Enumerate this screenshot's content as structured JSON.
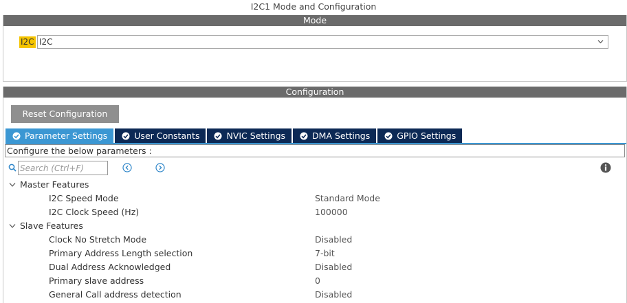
{
  "window": {
    "title": "I2C1 Mode and Configuration"
  },
  "mode": {
    "section_label": "Mode",
    "field_label": "I2C",
    "selected_value": "I2C"
  },
  "configuration": {
    "section_label": "Configuration",
    "reset_label": "Reset Configuration",
    "tabs": [
      {
        "label": "Parameter Settings",
        "active": true
      },
      {
        "label": "User Constants",
        "active": false
      },
      {
        "label": "NVIC Settings",
        "active": false
      },
      {
        "label": "DMA Settings",
        "active": false
      },
      {
        "label": "GPIO Settings",
        "active": false
      }
    ],
    "description": "Configure the below parameters :",
    "search": {
      "placeholder": "Search (Ctrl+F)",
      "value": ""
    },
    "groups": [
      {
        "label": "Master Features",
        "params": [
          {
            "name": "I2C Speed Mode",
            "value": "Standard Mode"
          },
          {
            "name": "I2C Clock Speed (Hz)",
            "value": "100000"
          }
        ]
      },
      {
        "label": "Slave Features",
        "params": [
          {
            "name": "Clock No Stretch Mode",
            "value": "Disabled"
          },
          {
            "name": "Primary Address Length selection",
            "value": "7-bit"
          },
          {
            "name": "Dual Address Acknowledged",
            "value": "Disabled"
          },
          {
            "name": "Primary slave address",
            "value": "0"
          },
          {
            "name": "General Call address detection",
            "value": "Disabled"
          }
        ]
      }
    ]
  },
  "colors": {
    "section_bar": "#6b6b6b",
    "tab_inactive": "#0c2955",
    "tab_active": "#3b97d3",
    "mode_tag": "#f5c400",
    "reset_button": "#8f8f8f"
  },
  "icons": {
    "tab_check": "check-circle-icon",
    "search": "search-icon",
    "previous": "circle-arrow-left-icon",
    "next": "circle-arrow-right-icon",
    "info": "info-icon",
    "group_toggle": "chevron-down-icon",
    "dropdown": "chevron-down-icon"
  }
}
